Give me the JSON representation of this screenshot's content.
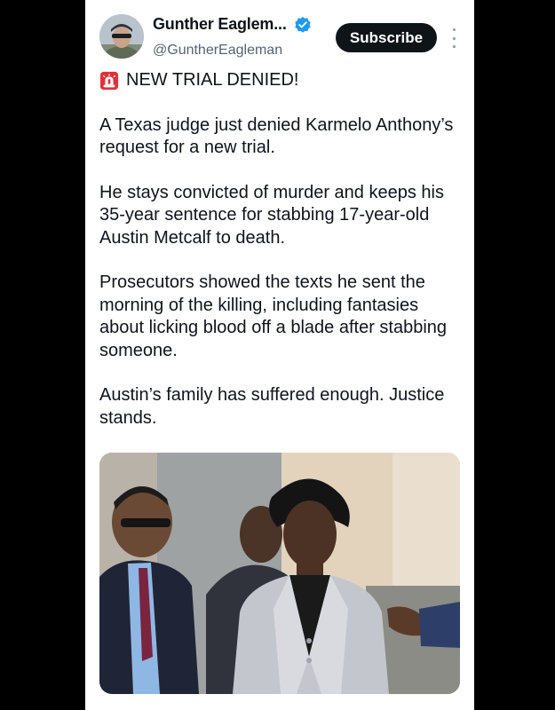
{
  "author": {
    "display_name": "Gunther Eaglem...",
    "handle": "@GuntherEagleman",
    "avatar_icon": "profile-avatar",
    "verified_icon": "verified-badge-icon"
  },
  "actions": {
    "subscribe_label": "Subscribe",
    "more_icon": "more-vertical-icon"
  },
  "post": {
    "headline_icon": "siren-emoji",
    "headline": "NEW TRIAL DENIED!",
    "paragraphs": [
      "A Texas judge just denied Karmelo Anthony’s request for a new trial.",
      "He stays convicted of murder and keeps his 35-year sentence for stabbing 17-year-old Austin Metcalf to death.",
      "Prosecutors showed the texts he sent the morning of the killing, including fantasies about licking blood off a blade after stabbing someone.",
      "Austin’s family has suffered enough. Justice stands."
    ]
  },
  "colors": {
    "background": "#000000",
    "card": "#ffffff",
    "text": "#0f1419",
    "secondary_text": "#536471",
    "verified_blue": "#1d9bf0",
    "button": "#0f1419"
  }
}
